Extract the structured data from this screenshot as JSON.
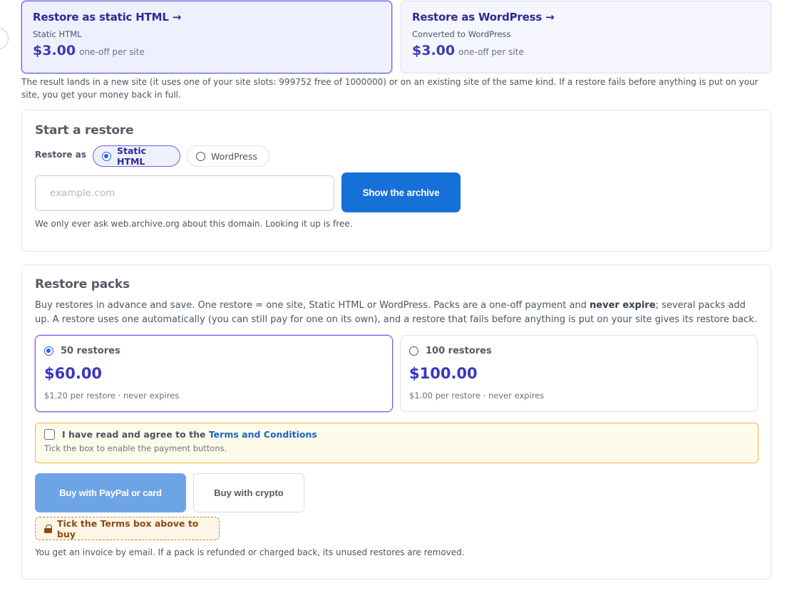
{
  "plans": [
    {
      "title": "Restore as static HTML →",
      "subtitle": "Static HTML",
      "price": "$3.00",
      "per": "one-off per site"
    },
    {
      "title": "Restore as WordPress →",
      "subtitle": "Converted to WordPress",
      "price": "$3.00",
      "per": "one-off per site"
    }
  ],
  "result_note": "The result lands in a new site (it uses one of your site slots: 999752 free of 1000000) or on an existing site of the same kind. If a restore fails before anything is put on your site, you get your money back in full.",
  "start": {
    "title": "Start a restore",
    "restore_as_label": "Restore as",
    "options": [
      "Static HTML",
      "WordPress"
    ],
    "selected": "Static HTML",
    "domain_placeholder": "example.com",
    "domain_value": "",
    "show_button": "Show the archive",
    "lookup_note": "We only ever ask web.archive.org about this domain. Looking it up is free."
  },
  "packs": {
    "title": "Restore packs",
    "desc_part1": "Buy restores in advance and save. One restore = one site, Static HTML or WordPress. Packs are a one-off payment and ",
    "desc_bold": "never expire",
    "desc_part2": "; several packs add up. A restore uses one automatically (you can still pay for one on its own), and a restore that fails before anything is put on your site gives its restore back.",
    "items": [
      {
        "label": "50 restores",
        "price": "$60.00",
        "per": "$1.20 per restore · never expires",
        "selected": true
      },
      {
        "label": "100 restores",
        "price": "$100.00",
        "per": "$1.00 per restore · never expires",
        "selected": false
      }
    ],
    "terms_prefix": "I have read and agree to the ",
    "terms_link": "Terms and Conditions",
    "terms_hint": "Tick the box to enable the payment buttons.",
    "buy_paypal": "Buy with PayPal or card",
    "buy_crypto": "Buy with crypto",
    "tick_warning": "Tick the Terms box above to buy",
    "invoice_note": "You get an invoice by email. If a pack is refunded or charged back, its unused restores are removed."
  },
  "colors": {
    "accent": "#3b3ab3",
    "primary_button": "#1570d8",
    "disabled_button": "#6da4e6",
    "terms_border": "#f2b43b",
    "warning_text": "#8a4a12"
  }
}
